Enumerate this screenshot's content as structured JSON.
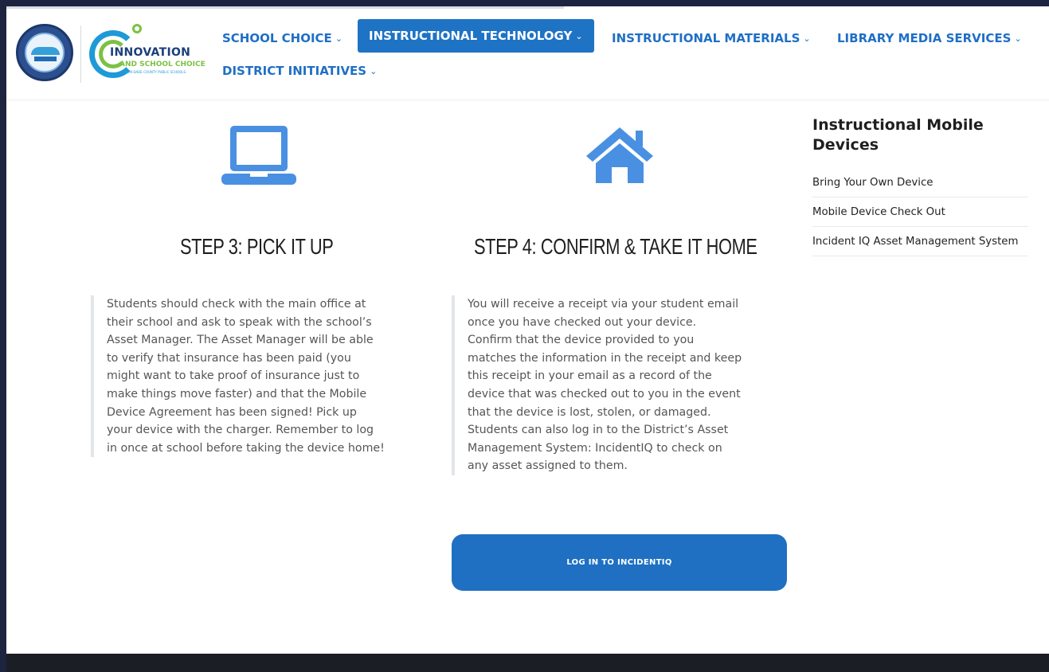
{
  "header": {
    "logos": {
      "district_seal": "Miami-Dade County Public Schools seal",
      "innovation_logo": {
        "line1": "INNOVATION",
        "line2": "AND SCHOOL CHOICE",
        "line3": "MIAMI-DADE COUNTY PUBLIC SCHOOLS"
      }
    },
    "nav": [
      {
        "label": "SCHOOL CHOICE",
        "active": false
      },
      {
        "label": "INSTRUCTIONAL TECHNOLOGY",
        "active": true
      },
      {
        "label": "INSTRUCTIONAL MATERIALS",
        "active": false
      },
      {
        "label": "LIBRARY MEDIA SERVICES",
        "active": false
      },
      {
        "label": "DISTRICT INITIATIVES",
        "active": false
      }
    ],
    "chevron": "⌄"
  },
  "steps": [
    {
      "icon": "laptop-icon",
      "title": "STEP 3: PICK IT UP",
      "lines": [
        "Students should check with the main office at",
        "their school and ask to speak with the school’s",
        "Asset Manager.  The Asset Manager will be able",
        "to verify that insurance has been paid (you",
        "might want to take proof of insurance just to",
        "make things move faster) and that the Mobile",
        "Device Agreement has been signed!  Pick up",
        "your device with the charger.  Remember to log",
        "in once at school before taking the device home!"
      ]
    },
    {
      "icon": "home-icon",
      "title": "STEP 4: CONFIRM & TAKE IT HOME",
      "lines": [
        "You will receive a receipt via your student email",
        "once you have checked out your device.",
        "Confirm that the device provided to you",
        "matches the information in the receipt and keep",
        "this receipt in your email as a record of the",
        "device that was checked out to you in the event",
        "that the device is lost, stolen, or damaged.",
        "Students can also log in to the District’s Asset",
        "Management System:  IncidentIQ to check on",
        "any asset assigned to them."
      ]
    }
  ],
  "cta": {
    "label": "LOG IN TO INCIDENTIQ"
  },
  "sidebar": {
    "title": "Instructional Mobile Devices",
    "links": [
      "Bring Your Own Device",
      "Mobile Device Check Out",
      "Incident IQ Asset Management System"
    ]
  },
  "colors": {
    "brand_blue": "#1f70c2",
    "icon_blue": "#4a90e2",
    "frame_bg": "#1d2440",
    "footer": "#1b1e24"
  }
}
